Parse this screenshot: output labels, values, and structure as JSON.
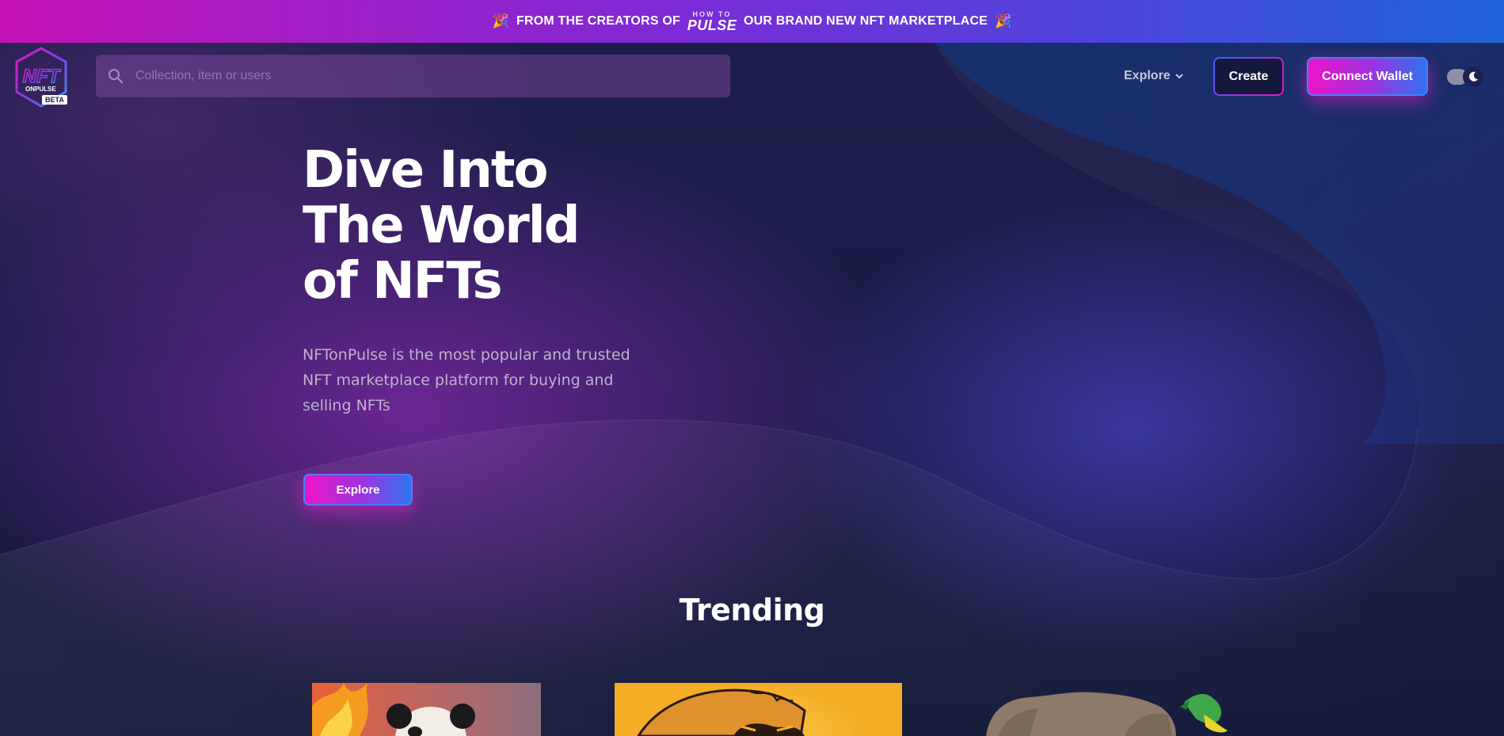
{
  "banner": {
    "left_emoji": "🎉",
    "prefix": "FROM THE CREATORS OF",
    "logo_top": "HOW TO",
    "logo_bottom": "PULSE",
    "suffix": "OUR BRAND NEW NFT MARKETPLACE",
    "right_emoji": "🎉"
  },
  "brand": {
    "logo_text": "NFT",
    "logo_sub": "ONPULSE",
    "badge": "BETA"
  },
  "search": {
    "placeholder": "Collection, item or users",
    "value": ""
  },
  "nav": {
    "explore_label": "Explore",
    "create_label": "Create",
    "connect_label": "Connect Wallet",
    "theme_toggle": "dark"
  },
  "hero": {
    "title_lines": [
      "Dive Into",
      "The World",
      "of NFTs"
    ],
    "description": "NFTonPulse is the most popular and trusted NFT marketplace platform for buying and selling NFTs",
    "cta_label": "Explore"
  },
  "trending": {
    "title": "Trending",
    "cards": [
      {
        "subject": "panda-nft"
      },
      {
        "subject": "fox-nft"
      },
      {
        "subject": "elephant-nft"
      }
    ]
  },
  "colors": {
    "background": "#14183d",
    "accent_pink": "#ec14c8",
    "accent_blue": "#2f73f0",
    "banner_start": "#c512b8",
    "banner_end": "#1f63d8"
  },
  "icons": {
    "search": "search-icon",
    "chevron": "chevron-down-icon",
    "theme": "moon-icon"
  }
}
